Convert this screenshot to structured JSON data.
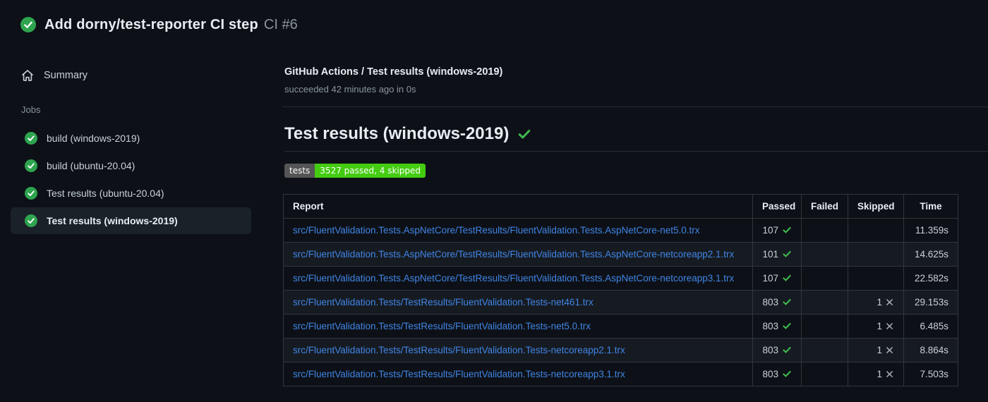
{
  "header": {
    "title": "Add dorny/test-reporter CI step",
    "run_number": "CI #6"
  },
  "sidebar": {
    "summary_label": "Summary",
    "jobs_label": "Jobs",
    "jobs": [
      {
        "label": "build (windows-2019)",
        "selected": false
      },
      {
        "label": "build (ubuntu-20.04)",
        "selected": false
      },
      {
        "label": "Test results (ubuntu-20.04)",
        "selected": false
      },
      {
        "label": "Test results (windows-2019)",
        "selected": true
      }
    ]
  },
  "main": {
    "check_run_title": "GitHub Actions / Test results (windows-2019)",
    "check_run_status": "succeeded 42 minutes ago in 0s",
    "heading": "Test results (windows-2019)",
    "badge": {
      "label": "tests",
      "value": "3527 passed, 4 skipped"
    },
    "table": {
      "columns": [
        "Report",
        "Passed",
        "Failed",
        "Skipped",
        "Time"
      ],
      "rows": [
        {
          "report": "src/FluentValidation.Tests.AspNetCore/TestResults/FluentValidation.Tests.AspNetCore-net5.0.trx",
          "passed": "107",
          "failed": "",
          "skipped": "",
          "time": "11.359s"
        },
        {
          "report": "src/FluentValidation.Tests.AspNetCore/TestResults/FluentValidation.Tests.AspNetCore-netcoreapp2.1.trx",
          "passed": "101",
          "failed": "",
          "skipped": "",
          "time": "14.625s"
        },
        {
          "report": "src/FluentValidation.Tests.AspNetCore/TestResults/FluentValidation.Tests.AspNetCore-netcoreapp3.1.trx",
          "passed": "107",
          "failed": "",
          "skipped": "",
          "time": "22.582s"
        },
        {
          "report": "src/FluentValidation.Tests/TestResults/FluentValidation.Tests-net461.trx",
          "passed": "803",
          "failed": "",
          "skipped": "1",
          "time": "29.153s"
        },
        {
          "report": "src/FluentValidation.Tests/TestResults/FluentValidation.Tests-net5.0.trx",
          "passed": "803",
          "failed": "",
          "skipped": "1",
          "time": "6.485s"
        },
        {
          "report": "src/FluentValidation.Tests/TestResults/FluentValidation.Tests-netcoreapp2.1.trx",
          "passed": "803",
          "failed": "",
          "skipped": "1",
          "time": "8.864s"
        },
        {
          "report": "src/FluentValidation.Tests/TestResults/FluentValidation.Tests-netcoreapp3.1.trx",
          "passed": "803",
          "failed": "",
          "skipped": "1",
          "time": "7.503s"
        }
      ]
    }
  },
  "icons": {
    "success_circle": "check-circle-filled-green",
    "summary": "home-outline",
    "passed": "green-check",
    "skipped": "gray-x"
  },
  "colors": {
    "page_bg": "#0d1117",
    "text_primary": "#e6edf3",
    "text_secondary": "#8b949e",
    "border": "#30363d",
    "divider": "#262c36",
    "link": "#4184e4",
    "success_green": "#3fb950",
    "circle_green": "#2ea44f",
    "x_gray": "#b1bac4",
    "badge_label_bg": "#555555",
    "badge_value_bg": "#44cc11",
    "selected_item_bg": "#1b2129",
    "row_alt_bg": "#161b22"
  }
}
